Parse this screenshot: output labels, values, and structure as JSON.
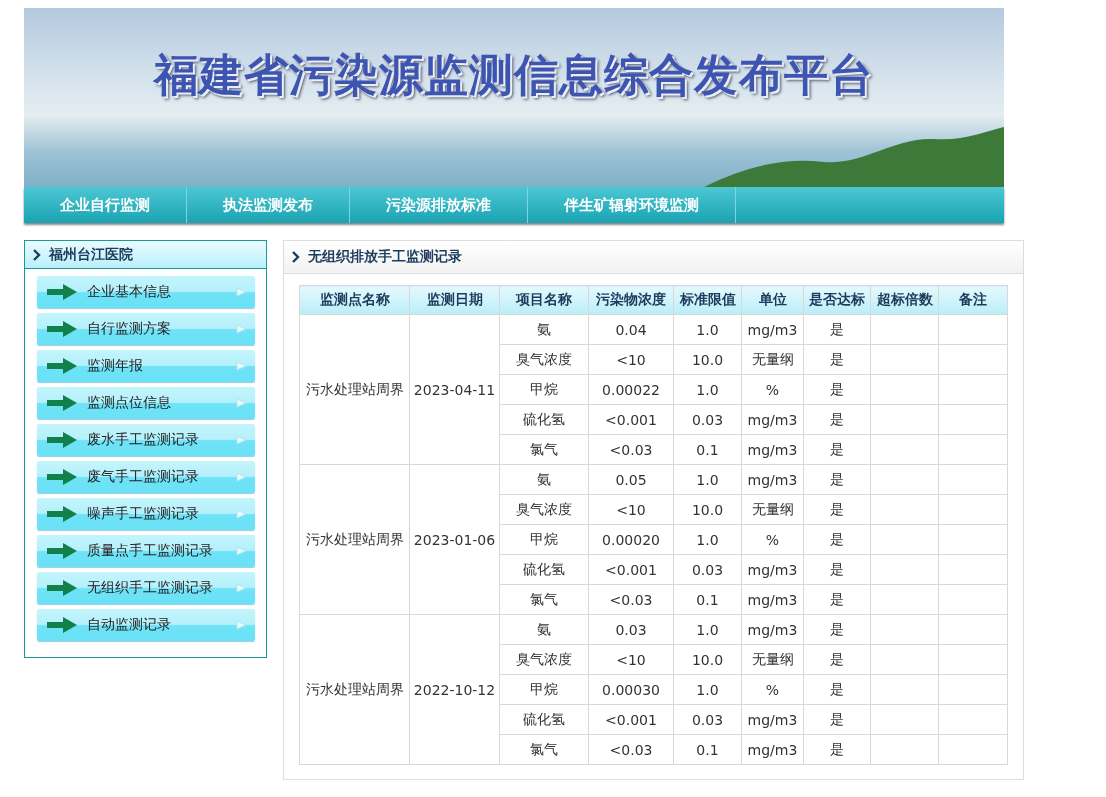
{
  "banner": {
    "title": "福建省污染源监测信息综合发布平台"
  },
  "nav": [
    "企业自行监测",
    "执法监测发布",
    "污染源排放标准",
    "伴生矿辐射环境监测"
  ],
  "sidebar": {
    "title": "福州台江医院",
    "items": [
      "企业基本信息",
      "自行监测方案",
      "监测年报",
      "监测点位信息",
      "废水手工监测记录",
      "废气手工监测记录",
      "噪声手工监测记录",
      "质量点手工监测记录",
      "无组织手工监测记录",
      "自动监测记录"
    ]
  },
  "panel": {
    "title": "无组织排放手工监测记录"
  },
  "table": {
    "columns": [
      "监测点名称",
      "监测日期",
      "项目名称",
      "污染物浓度",
      "标准限值",
      "单位",
      "是否达标",
      "超标倍数",
      "备注"
    ],
    "groups": [
      {
        "site": "污水处理站周界",
        "date": "2023-04-11",
        "rows": [
          {
            "item": "氨",
            "value": "0.04",
            "limit": "1.0",
            "unit": "mg/m3",
            "ok": "是"
          },
          {
            "item": "臭气浓度",
            "value": "<10",
            "limit": "10.0",
            "unit": "无量纲",
            "ok": "是"
          },
          {
            "item": "甲烷",
            "value": "0.00022",
            "limit": "1.0",
            "unit": "%",
            "ok": "是"
          },
          {
            "item": "硫化氢",
            "value": "<0.001",
            "limit": "0.03",
            "unit": "mg/m3",
            "ok": "是"
          },
          {
            "item": "氯气",
            "value": "<0.03",
            "limit": "0.1",
            "unit": "mg/m3",
            "ok": "是"
          }
        ]
      },
      {
        "site": "污水处理站周界",
        "date": "2023-01-06",
        "rows": [
          {
            "item": "氨",
            "value": "0.05",
            "limit": "1.0",
            "unit": "mg/m3",
            "ok": "是"
          },
          {
            "item": "臭气浓度",
            "value": "<10",
            "limit": "10.0",
            "unit": "无量纲",
            "ok": "是"
          },
          {
            "item": "甲烷",
            "value": "0.00020",
            "limit": "1.0",
            "unit": "%",
            "ok": "是"
          },
          {
            "item": "硫化氢",
            "value": "<0.001",
            "limit": "0.03",
            "unit": "mg/m3",
            "ok": "是"
          },
          {
            "item": "氯气",
            "value": "<0.03",
            "limit": "0.1",
            "unit": "mg/m3",
            "ok": "是"
          }
        ]
      },
      {
        "site": "污水处理站周界",
        "date": "2022-10-12",
        "rows": [
          {
            "item": "氨",
            "value": "0.03",
            "limit": "1.0",
            "unit": "mg/m3",
            "ok": "是"
          },
          {
            "item": "臭气浓度",
            "value": "<10",
            "limit": "10.0",
            "unit": "无量纲",
            "ok": "是"
          },
          {
            "item": "甲烷",
            "value": "0.00030",
            "limit": "1.0",
            "unit": "%",
            "ok": "是"
          },
          {
            "item": "硫化氢",
            "value": "<0.001",
            "limit": "0.03",
            "unit": "mg/m3",
            "ok": "是"
          },
          {
            "item": "氯气",
            "value": "<0.03",
            "limit": "0.1",
            "unit": "mg/m3",
            "ok": "是"
          }
        ]
      }
    ]
  }
}
